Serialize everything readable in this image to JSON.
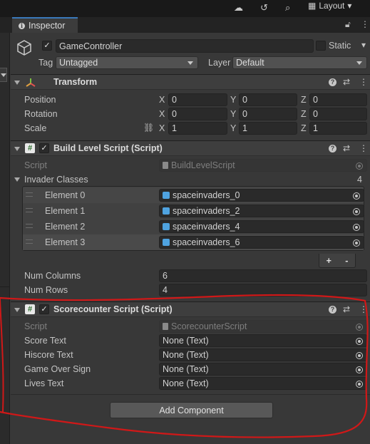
{
  "toolbar": {
    "layout_label": "Layout"
  },
  "tab": {
    "title": "Inspector"
  },
  "gameobject": {
    "name": "GameController",
    "static_label": "Static",
    "tag_label": "Tag",
    "tag_value": "Untagged",
    "layer_label": "Layer",
    "layer_value": "Default"
  },
  "transform": {
    "title": "Transform",
    "rows": [
      {
        "label": "Position",
        "x": "0",
        "y": "0",
        "z": "0"
      },
      {
        "label": "Rotation",
        "x": "0",
        "y": "0",
        "z": "0"
      },
      {
        "label": "Scale",
        "x": "1",
        "y": "1",
        "z": "1"
      }
    ],
    "axes": {
      "x": "X",
      "y": "Y",
      "z": "Z"
    }
  },
  "build_level": {
    "title": "Build Level Script (Script)",
    "script_label": "Script",
    "script_value": "BuildLevelScript",
    "list_label": "Invader Classes",
    "list_count": "4",
    "elements": [
      {
        "label": "Element 0",
        "value": "spaceinvaders_0"
      },
      {
        "label": "Element 1",
        "value": "spaceinvaders_2"
      },
      {
        "label": "Element 2",
        "value": "spaceinvaders_4"
      },
      {
        "label": "Element 3",
        "value": "spaceinvaders_6"
      }
    ],
    "plus": "+",
    "minus": "-",
    "num_columns_label": "Num Columns",
    "num_columns": "6",
    "num_rows_label": "Num Rows",
    "num_rows": "4"
  },
  "scorecounter": {
    "title": "Scorecounter Script (Script)",
    "script_label": "Script",
    "script_value": "ScorecounterScript",
    "fields": [
      {
        "label": "Score Text",
        "value": "None (Text)"
      },
      {
        "label": "Hiscore Text",
        "value": "None (Text)"
      },
      {
        "label": "Game Over Sign",
        "value": "None (Text)"
      },
      {
        "label": "Lives Text",
        "value": "None (Text)"
      }
    ]
  },
  "add_component": "Add Component",
  "colors": {
    "accent_tab": "#3a79bb",
    "annotation": "#d01818",
    "object_icon": "#4fa3e0"
  }
}
